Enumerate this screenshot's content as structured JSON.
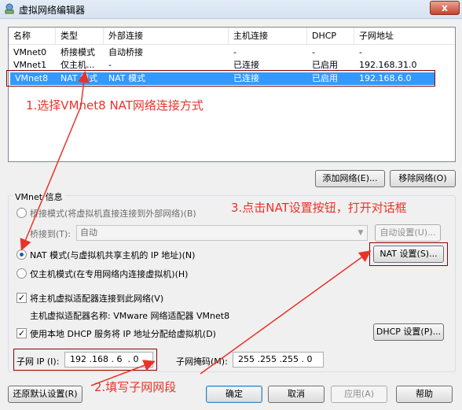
{
  "window": {
    "title": "虚拟网络编辑器",
    "close_label": "x"
  },
  "table": {
    "columns": [
      "名称",
      "类型",
      "外部连接",
      "主机连接",
      "DHCP",
      "子网地址"
    ],
    "rows": [
      [
        "VMnet0",
        "桥接模式",
        "自动桥接",
        "-",
        "-",
        "-"
      ],
      [
        "VMnet1",
        "仅主机...",
        "-",
        "已连接",
        "已启用",
        "192.168.31.0"
      ],
      [
        "VMnet8",
        "NAT 模式",
        "NAT 模式",
        "已连接",
        "已启用",
        "192.168.6.0"
      ]
    ]
  },
  "buttons": {
    "add_network": "添加网络(E)...",
    "remove_network": "移除网络(O)",
    "auto_settings": "自动设置(U)...",
    "nat_settings": "NAT 设置(S)...",
    "dhcp_settings": "DHCP 设置(P)...",
    "restore_defaults": "还原默认设置(R)",
    "ok": "确定",
    "cancel": "取消",
    "apply": "应用(A)",
    "help": "帮助"
  },
  "vmnet_info": {
    "group_title": "VMnet 信息",
    "bridged_label": "桥接模式(将虚拟机直接连接到外部网络)(B)",
    "bridged_to_label": "桥接到(T):",
    "bridged_to_value": "自动",
    "nat_label": "NAT 模式(与虚拟机共享主机的 IP 地址)(N)",
    "hostonly_label": "仅主机模式(在专用网络内连接虚拟机)(H)",
    "connect_adapter_label": "将主机虚拟适配器连接到此网络(V)",
    "adapter_name_label": "主机虚拟适配器名称: VMware 网络适配器 VMnet8",
    "dhcp_label": "使用本地 DHCP 服务将 IP 地址分配给虚拟机(D)",
    "subnet_ip_label": "子网 IP (I):",
    "subnet_ip_value": "192 .168 . 6  . 0",
    "subnet_mask_label": "子网掩码(M):",
    "subnet_mask_value": "255 .255 .255 . 0",
    "mode": "nat",
    "connect_adapter_checked": true,
    "dhcp_checked": true
  },
  "annotations": {
    "step1": "1.选择VMnet8 NAT网络连接方式",
    "step2": "2.填写子网网段",
    "step3": "3.点击NAT设置按钮，打开对话框",
    "color": "#e8332a"
  },
  "colors": {
    "selection": "#3399ff",
    "annotation_box": "#8b0000"
  }
}
